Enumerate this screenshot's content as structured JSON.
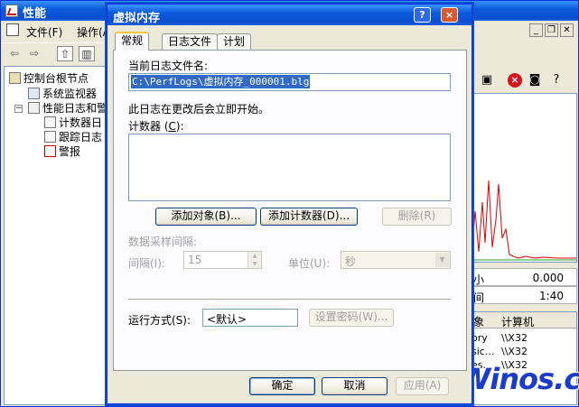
{
  "main_window": {
    "title": "性能",
    "menu": {
      "file": "文件(F)",
      "action": "操作(A"
    },
    "tree": {
      "root": "控制台根节点",
      "system_monitor": "系统监视器",
      "perf_logs": "性能日志和警",
      "counter_logs": "计数器日",
      "trace_logs": "跟踪日志",
      "alerts": "警报"
    },
    "stats": [
      {
        "label": "小",
        "value": "0.000"
      },
      {
        "label": "间",
        "value": "1:40"
      }
    ],
    "list_headers": {
      "object": "象",
      "computer": "计算机"
    },
    "list_rows": [
      {
        "object": "ory",
        "computer": "\\\\X32"
      },
      {
        "object": "sic...",
        "computer": "\\\\X32"
      },
      {
        "object": "es...",
        "computer": "\\\\X32"
      },
      {
        "object": "",
        "computer": ""
      }
    ],
    "chart_color": "#e00000",
    "watermark": "Winos.cn"
  },
  "dialog": {
    "title": "虚拟内存",
    "help_button": "?",
    "close_button": "×",
    "tabs": [
      "常规",
      "日志文件",
      "计划"
    ],
    "current_log_label": "当前日志文件名:",
    "current_log_value": "C:\\PerfLogs\\虚拟内存_000001.blg",
    "info_text": "此日志在更改后会立即开始。",
    "counters_label_pre": "计数器 (",
    "counters_label_key": "C",
    "counters_label_post": "):",
    "add_object": "添加对象(B)...",
    "add_counter": "添加计数器(D)...",
    "remove": "删除(R)",
    "sample_interval_label": "数据采样间隔:",
    "interval_label": "间隔(I):",
    "interval_value": "15",
    "units_label": "单位(U):",
    "units_value": "秒",
    "run_as_label": "运行方式(S):",
    "run_as_value": "<默认>",
    "set_password": "设置密码(W)...",
    "ok": "确定",
    "cancel": "取消",
    "apply": "应用(A)"
  }
}
